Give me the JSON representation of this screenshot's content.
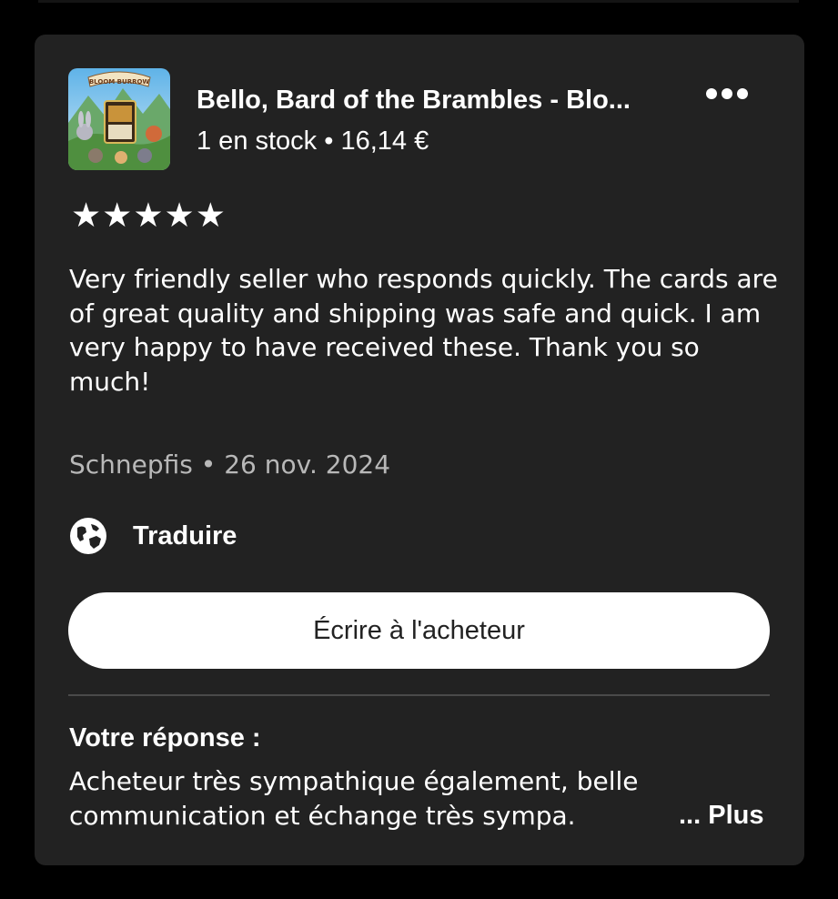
{
  "listing": {
    "title": "Bello, Bard of the Brambles - Blo...",
    "stock_line": "1 en stock • 16,14 €",
    "thumbnail_banner_text": "BLOOM BURROW"
  },
  "more_icon": "more-horizontal-icon",
  "rating": {
    "stars": 5,
    "max": 5,
    "glyph": "★"
  },
  "review": {
    "text": "Very friendly seller who responds quickly. The cards are of great quality and shipping was safe and quick. I am very happy to have received these. Thank you so much!",
    "meta": "Schnepfis • 26 nov. 2024"
  },
  "translate": {
    "icon": "globe-icon",
    "label": "Traduire"
  },
  "write_button": {
    "label": "Écrire à l'acheteur"
  },
  "reply": {
    "title": "Votre réponse :",
    "text": "Acheteur très sympathique également, belle communication et échange très sympa.",
    "more_label": "... Plus"
  },
  "colors": {
    "background": "#000000",
    "card": "#222222",
    "text": "#ffffff",
    "muted_text": "#b8b8b8",
    "button_bg": "#ffffff",
    "button_text": "#222222",
    "divider": "#4a4a4a"
  }
}
